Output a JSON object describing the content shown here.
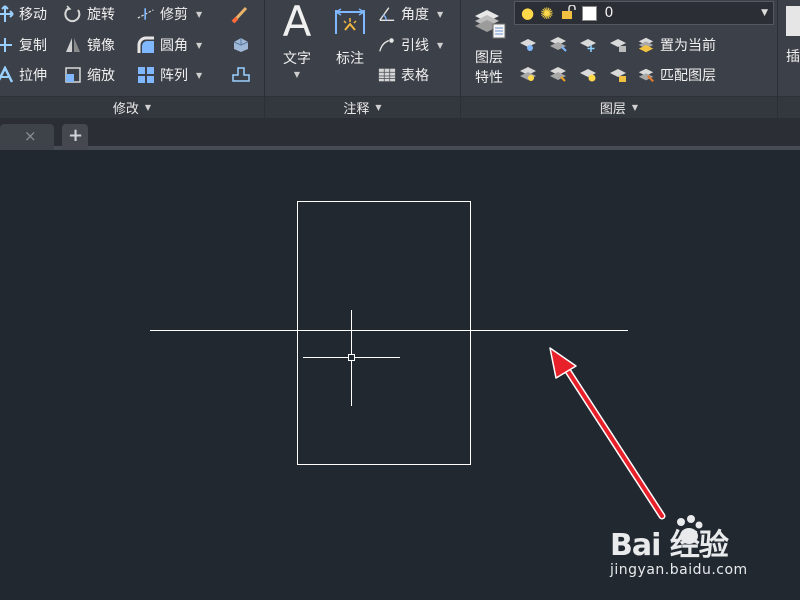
{
  "ribbon": {
    "modify": {
      "title": "修改",
      "tools": {
        "move": "移动",
        "rotate": "旋转",
        "trim": "修剪",
        "copy": "复制",
        "mirror": "镜像",
        "fillet": "圆角",
        "stretch": "拉伸",
        "scale": "缩放",
        "array": "阵列"
      }
    },
    "annotation": {
      "title": "注释",
      "text": "文字",
      "dimension": "标注",
      "angle": "角度",
      "leader": "引线",
      "table": "表格"
    },
    "layers": {
      "title": "图层",
      "properties_line1": "图层",
      "properties_line2": "特性",
      "current_layer": "0",
      "make_current": "置为当前",
      "match_layer": "匹配图层"
    },
    "insert": {
      "label": "插"
    }
  },
  "tabs": {
    "new_tab": "+",
    "close": "×"
  },
  "watermark": {
    "brand": "Bai 经验",
    "url": "jingyan.baidu.com"
  },
  "colors": {
    "canvas": "#212830",
    "ribbon": "#3c4048",
    "annotation_arrow": "#e8202a",
    "geometry": "#ffffff"
  }
}
